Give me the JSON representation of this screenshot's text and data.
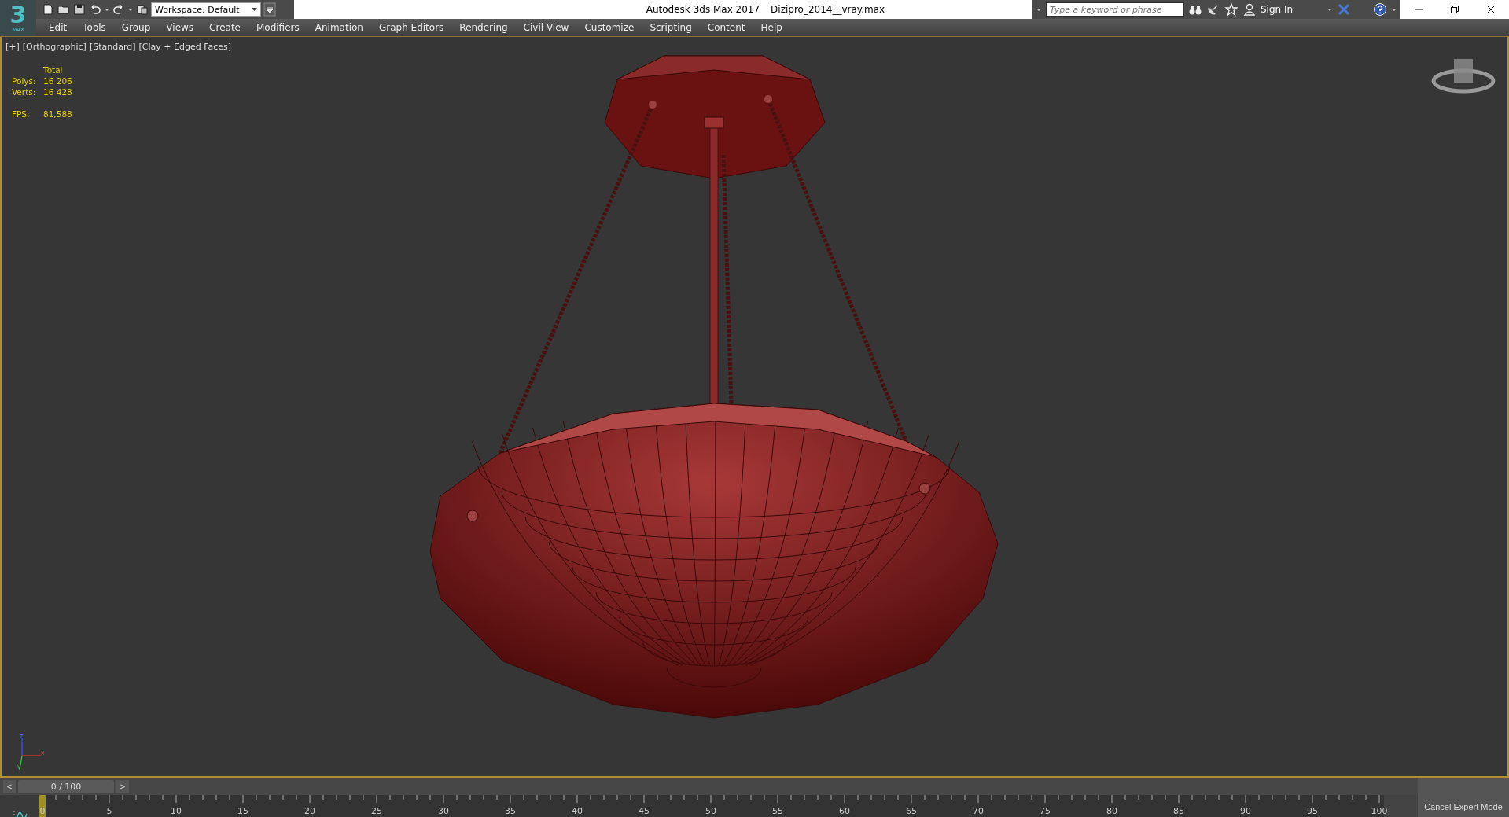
{
  "logo": {
    "glyph": "3",
    "caption": "MAX"
  },
  "toolbar": {
    "workspace": "Workspace: Default"
  },
  "window": {
    "app": "Autodesk 3ds Max 2017",
    "file": "Dizipro_2014__vray.max"
  },
  "infocenter": {
    "search": {
      "placeholder": "Type a keyword or phrase"
    },
    "sign_in": "Sign In"
  },
  "menu": [
    "Edit",
    "Tools",
    "Group",
    "Views",
    "Create",
    "Modifiers",
    "Animation",
    "Graph Editors",
    "Rendering",
    "Civil View",
    "Customize",
    "Scripting",
    "Content",
    "Help"
  ],
  "viewport": {
    "active": true,
    "labels": [
      "[+]",
      "[Orthographic]",
      "[Standard]",
      "[Clay + Edged Faces]"
    ],
    "stats": {
      "header": "Total",
      "rows": [
        {
          "label": "Polys:",
          "value": "16 206"
        },
        {
          "label": "Verts:",
          "value": "16 428"
        }
      ],
      "fps_label": "FPS:",
      "fps_value": "81,588"
    },
    "axes": [
      "z",
      "x",
      "y"
    ]
  },
  "timeline": {
    "prev": "<",
    "frame": "0 / 100",
    "next": ">",
    "level": 0,
    "ticks": [
      "0",
      "5",
      "10",
      "15",
      "20",
      "25",
      "30",
      "35",
      "40",
      "45",
      "50",
      "55",
      "60",
      "65",
      "70",
      "75",
      "80",
      "85",
      "90",
      "95",
      "100"
    ]
  },
  "status": {
    "expert_button": "Cancel Expert Mode"
  }
}
